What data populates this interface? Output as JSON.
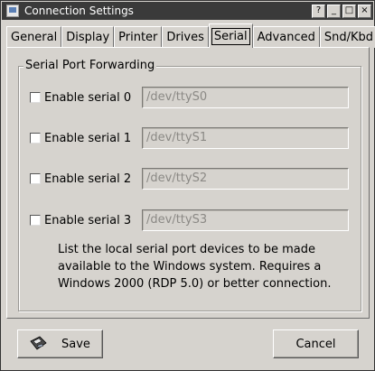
{
  "window": {
    "title": "Connection Settings",
    "controls": [
      "?",
      "_",
      "□",
      "×"
    ]
  },
  "tabs": [
    {
      "label": "General"
    },
    {
      "label": "Display"
    },
    {
      "label": "Printer"
    },
    {
      "label": "Drives"
    },
    {
      "label": "Serial",
      "active": true
    },
    {
      "label": "Advanced"
    },
    {
      "label": "Snd/Kbd"
    }
  ],
  "serial": {
    "group_title": "Serial Port Forwarding",
    "ports": [
      {
        "label": "Enable serial 0",
        "placeholder": "/dev/ttyS0",
        "checked": false
      },
      {
        "label": "Enable serial 1",
        "placeholder": "/dev/ttyS1",
        "checked": false
      },
      {
        "label": "Enable serial 2",
        "placeholder": "/dev/ttyS2",
        "checked": false
      },
      {
        "label": "Enable serial 3",
        "placeholder": "/dev/ttyS3",
        "checked": false
      }
    ],
    "help_lines": [
      "List the local serial port devices to be made",
      "available to the Windows system. Requires a",
      "Windows 2000 (RDP 5.0) or better connection."
    ]
  },
  "buttons": {
    "save_label": "Save",
    "cancel_label": "Cancel"
  },
  "colors": {
    "window_bg": "#d6d3ce",
    "titlebar_bg": "#3a3a3a"
  }
}
